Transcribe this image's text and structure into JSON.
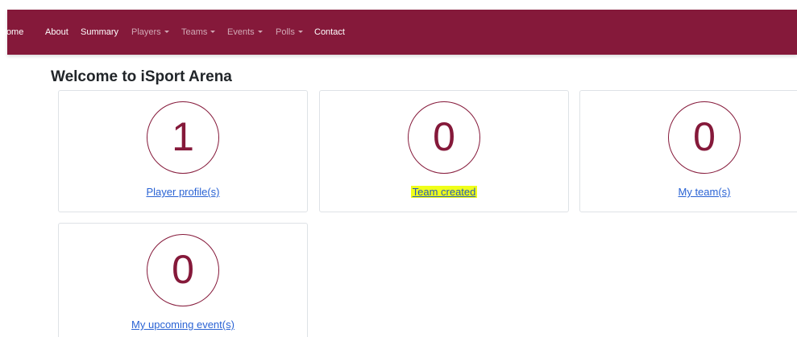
{
  "nav": {
    "items": [
      {
        "label": "Home"
      },
      {
        "label": "About"
      },
      {
        "label": "Summary"
      },
      {
        "label": "Players"
      },
      {
        "label": "Teams"
      },
      {
        "label": "Events"
      },
      {
        "label": "Polls"
      },
      {
        "label": "Contact"
      }
    ],
    "colors": {
      "background": "#85193a",
      "active_text": "#ffffff",
      "dropdown_text": "rgba(255,255,255,0.62)"
    }
  },
  "main": {
    "title": "Welcome to iSport Arena",
    "cards": [
      {
        "count": "1",
        "link": "Player profile(s)"
      },
      {
        "count": "0",
        "link": "Team created",
        "highlighted": true
      },
      {
        "count": "0",
        "link": "My team(s)"
      },
      {
        "count": "0",
        "link": "My upcoming event(s)"
      }
    ],
    "colors": {
      "accent": "#85193a",
      "link": "#2a63d4",
      "highlight": "#f0ff1a"
    }
  }
}
